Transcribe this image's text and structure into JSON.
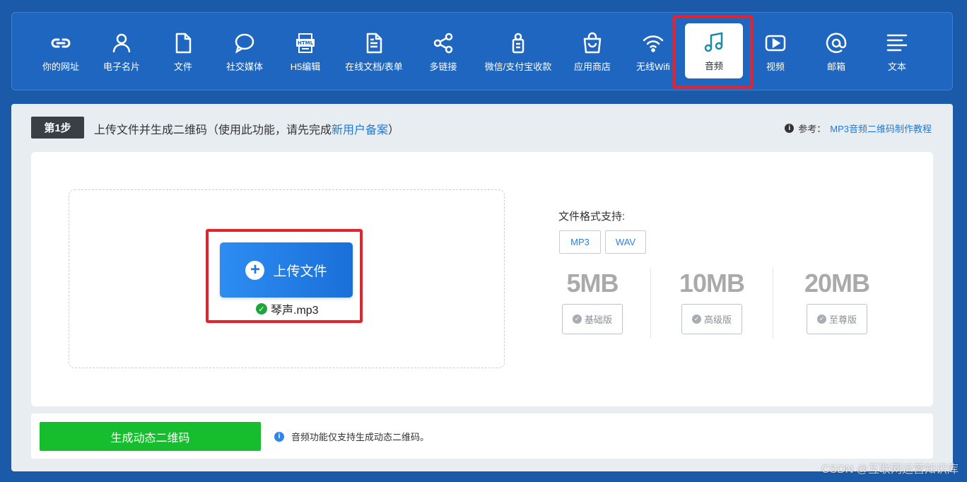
{
  "nav": {
    "items": [
      {
        "label": "你的网址",
        "icon": "link-icon"
      },
      {
        "label": "电子名片",
        "icon": "person-icon"
      },
      {
        "label": "文件",
        "icon": "file-icon"
      },
      {
        "label": "社交媒体",
        "icon": "chat-bubble-icon"
      },
      {
        "label": "H5编辑",
        "icon": "html-file-icon"
      },
      {
        "label": "在线文档/表单",
        "icon": "document-icon"
      },
      {
        "label": "多链接",
        "icon": "share-icon"
      },
      {
        "label": "微信/支付宝收款",
        "icon": "payment-icon"
      },
      {
        "label": "应用商店",
        "icon": "shopping-bag-icon"
      },
      {
        "label": "无线Wifi",
        "icon": "wifi-icon"
      },
      {
        "label": "音频",
        "icon": "music-note-icon",
        "active": true
      },
      {
        "label": "视频",
        "icon": "video-play-icon"
      },
      {
        "label": "邮箱",
        "icon": "at-sign-icon"
      },
      {
        "label": "文本",
        "icon": "text-lines-icon"
      }
    ]
  },
  "step": {
    "badge": "第1步",
    "text_prefix": "上传文件并生成二维码（使用此功能，请先完成",
    "link": "新用户备案",
    "text_suffix": "）"
  },
  "reference": {
    "label": "参考：",
    "link": "MP3音频二维码制作教程"
  },
  "upload": {
    "button_label": "上传文件",
    "filename": "琴声.mp3"
  },
  "formats": {
    "label": "文件格式支持:",
    "tags": [
      "MP3",
      "WAV"
    ]
  },
  "tiers": [
    {
      "size": "5MB",
      "label": "基础版"
    },
    {
      "size": "10MB",
      "label": "高级版"
    },
    {
      "size": "20MB",
      "label": "至尊版"
    }
  ],
  "generate": {
    "button_label": "生成动态二维码",
    "note": "音频功能仅支持生成动态二维码。"
  },
  "watermark": "CSDN @互联网运营知识库",
  "colors": {
    "background": "#1a5aa8",
    "nav": "#1f66c0",
    "highlight": "#e8222b",
    "upload_button": "#1f78e0",
    "generate_button": "#16bd2c"
  }
}
